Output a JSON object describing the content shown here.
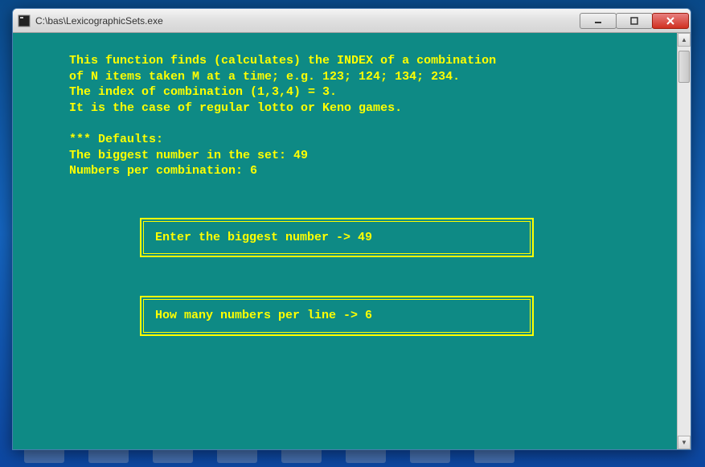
{
  "window": {
    "title": "C:\\bas\\LexicographicSets.exe"
  },
  "console": {
    "intro": {
      "line1": "This function finds (calculates) the INDEX of a combination",
      "line2": "of N items taken M at a time; e.g. 123; 124; 134; 234.",
      "line3": "The index of combination (1,3,4) = 3.",
      "line4": "It is the case of regular lotto or Keno games."
    },
    "defaults": {
      "header": "*** Defaults:",
      "biggest_label": "The biggest number in the set: ",
      "biggest_value": "49",
      "perline_label": "Numbers per combination: ",
      "perline_value": "6"
    },
    "prompts": {
      "biggest": {
        "label": "Enter the biggest number -> ",
        "value": "49"
      },
      "perline": {
        "label": "How many numbers per line -> ",
        "value": "6"
      }
    }
  }
}
